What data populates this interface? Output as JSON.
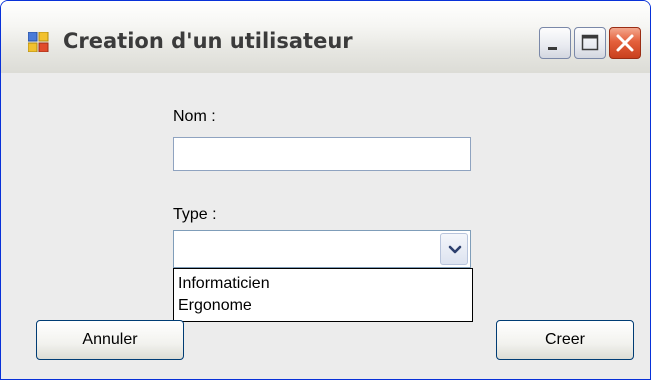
{
  "window": {
    "title": "Creation d'un utilisateur"
  },
  "form": {
    "name_label": "Nom :",
    "name_value": "",
    "type_label": "Type :",
    "type_selected": ""
  },
  "dropdown": {
    "options": [
      "Informaticien",
      "Ergonome"
    ]
  },
  "buttons": {
    "cancel_label": "Annuler",
    "create_label": "Creer"
  },
  "icons": {
    "app": "form-window-icon",
    "minimize": "minimize-icon",
    "maximize": "maximize-icon",
    "close": "close-icon",
    "dropdown": "chevron-down-icon"
  },
  "colors": {
    "window_border": "#0831d9",
    "close_button": "#e4603c",
    "client_background": "#ececec",
    "button_border": "#003c74"
  }
}
